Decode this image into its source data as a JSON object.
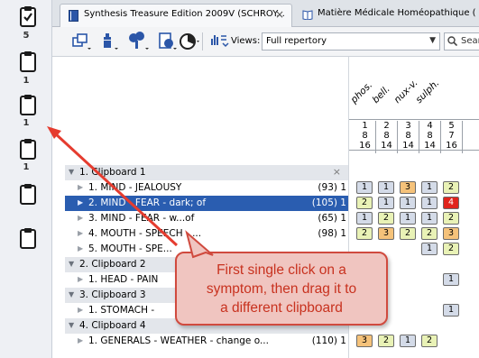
{
  "clipboards": [
    {
      "icon": "clipboard-check-icon",
      "count": "5"
    },
    {
      "icon": "clipboard-icon",
      "count": "1"
    },
    {
      "icon": "clipboard-icon",
      "count": "1"
    },
    {
      "icon": "clipboard-icon",
      "count": "1"
    },
    {
      "icon": "clipboard-icon",
      "count": ""
    },
    {
      "icon": "clipboard-icon",
      "count": ""
    }
  ],
  "tabs": [
    {
      "label": "Synthesis Treasure Edition 2009V (SCHROY...",
      "close": "×"
    },
    {
      "label": "Matière Médicale Homéopathique ("
    }
  ],
  "toolbar": {
    "views_label": "Views:",
    "views_value": "Full repertory",
    "search_placeholder": "Search r"
  },
  "grid": {
    "remedies": [
      "phos.",
      "bell.",
      "nux-v.",
      "sulph.",
      ""
    ],
    "header_rows": [
      [
        "1",
        "2",
        "3",
        "4",
        "5"
      ],
      [
        "8",
        "8",
        "8",
        "8",
        "7"
      ],
      [
        "16",
        "14",
        "14",
        "14",
        "16"
      ]
    ],
    "rows": [
      [
        "1",
        "1",
        "3",
        "1",
        "2"
      ],
      [
        "2",
        "1",
        "1",
        "1",
        "4"
      ],
      [
        "1",
        "2",
        "1",
        "1",
        "2"
      ],
      [
        "2",
        "3",
        "2",
        "2",
        "3"
      ],
      [
        "",
        "",
        "",
        "1",
        "2"
      ],
      [
        "",
        "",
        "",
        "",
        ""
      ],
      [
        "",
        "",
        "",
        "",
        "1"
      ],
      [
        "",
        "",
        "",
        "",
        ""
      ],
      [
        "",
        "",
        "",
        "",
        "1"
      ],
      [
        "",
        "",
        "",
        "",
        ""
      ],
      [
        "3",
        "2",
        "1",
        "2",
        ""
      ]
    ]
  },
  "tree": [
    {
      "type": "group",
      "label": "1. Clipboard 1",
      "count": "",
      "close": "×"
    },
    {
      "type": "item",
      "label": "1. MIND - JEALOUSY",
      "count": "(93) 1"
    },
    {
      "type": "item",
      "label": "2. MIND - FEAR - dark; of",
      "count": "(105) 1",
      "selected": true
    },
    {
      "type": "item",
      "label": "3. MIND - FEAR - w...of",
      "count": "(65) 1"
    },
    {
      "type": "item",
      "label": "4. MOUTH - SPEECH - ...",
      "count": "(98) 1"
    },
    {
      "type": "item",
      "label": "5. MOUTH - SPE...",
      "count": ""
    },
    {
      "type": "group",
      "label": "2. Clipboard 2",
      "count": ""
    },
    {
      "type": "item",
      "label": "1. HEAD - PAIN",
      "count": ""
    },
    {
      "type": "group",
      "label": "3. Clipboard 3",
      "count": ""
    },
    {
      "type": "item",
      "label": "1. STOMACH -",
      "count": ""
    },
    {
      "type": "group",
      "label": "4. Clipboard 4",
      "count": ""
    },
    {
      "type": "item",
      "label": "1. GENERALS - WEATHER - change o...",
      "count": "(110) 1"
    }
  ],
  "callout": {
    "text_line1": "First single click on a",
    "text_line2": "symptom, then drag it to",
    "text_line3": "a different clipboard"
  },
  "colors": {
    "selection": "#2a5db0",
    "callout_border": "#d04a3e",
    "callout_fill": "#f0c5c0",
    "grade_red": "#e0241c",
    "grade_orange": "#f5c27a",
    "grade_yellow": "#e9f2b6",
    "grade_gray": "#d4dbe8"
  }
}
